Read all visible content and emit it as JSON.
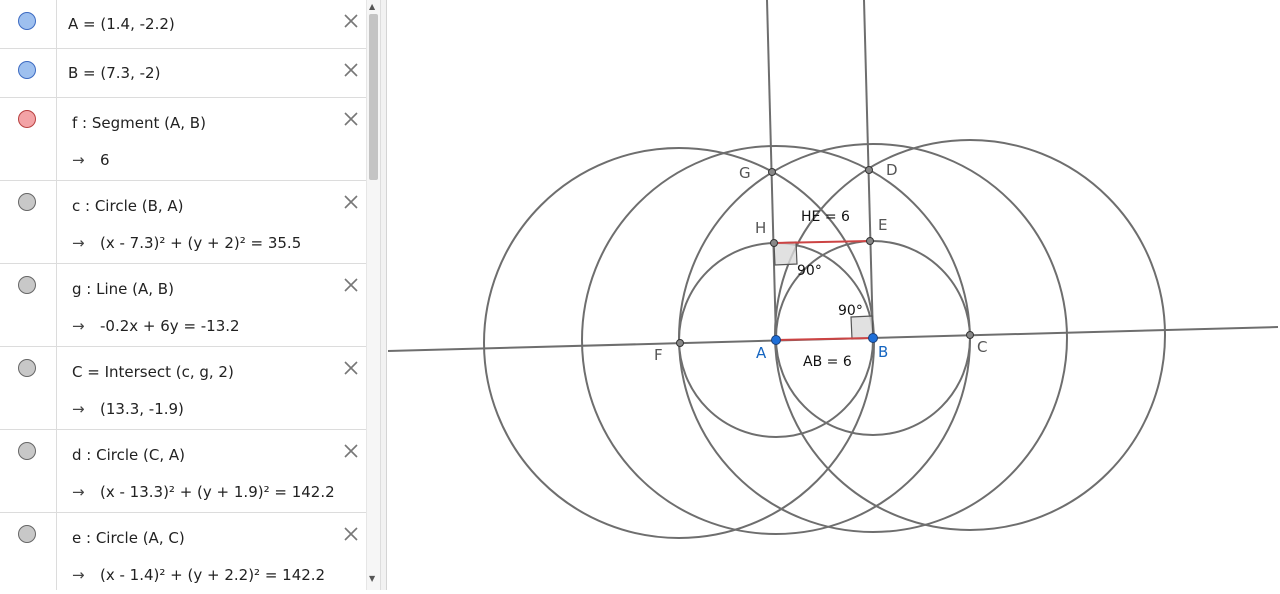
{
  "algebra": {
    "rows": [
      {
        "def": "A = (1.4, -2.2)",
        "value": null,
        "color": "#9ec0ef",
        "border": "#3d6bc2"
      },
      {
        "def": "B = (7.3, -2)",
        "value": null,
        "color": "#9ec0ef",
        "border": "#3d6bc2"
      },
      {
        "def": "f : Segment (A, B)",
        "value": "6",
        "color": "#f3a3a6",
        "border": "#b84040"
      },
      {
        "def": "c : Circle (B, A)",
        "value": "(x - 7.3)² + (y + 2)² = 35.5",
        "color": "#c8c8c8",
        "border": "#666666"
      },
      {
        "def": "g : Line (A, B)",
        "value": "-0.2x + 6y = -13.2",
        "color": "#c8c8c8",
        "border": "#666666"
      },
      {
        "def": "C = Intersect (c, g, 2)",
        "value": "(13.3, -1.9)",
        "color": "#c8c8c8",
        "border": "#666666"
      },
      {
        "def": "d : Circle (C, A)",
        "value": "(x - 13.3)² + (y + 1.9)² = 142.2",
        "color": "#c8c8c8",
        "border": "#666666"
      },
      {
        "def": "e : Circle (A, C)",
        "value": "(x - 1.4)² + (y + 2.2)² = 142.2",
        "color": "#c8c8c8",
        "border": "#666666"
      }
    ]
  },
  "graphics": {
    "points": [
      {
        "label": "A",
        "label_color": "#1565c0",
        "fill": "#1e6fd8"
      },
      {
        "label": "B",
        "label_color": "#1565c0",
        "fill": "#1e6fd8"
      },
      {
        "label": "C",
        "label_color": "#555555",
        "fill": "#888888"
      },
      {
        "label": "D",
        "label_color": "#555555",
        "fill": "#888888"
      },
      {
        "label": "E",
        "label_color": "#555555",
        "fill": "#888888"
      },
      {
        "label": "F",
        "label_color": "#555555",
        "fill": "#888888"
      },
      {
        "label": "G",
        "label_color": "#555555",
        "fill": "#888888"
      },
      {
        "label": "H",
        "label_color": "#555555",
        "fill": "#888888"
      }
    ],
    "angle_labels": [
      "90°",
      "90°"
    ],
    "segment_labels": [
      "AB = 6",
      "HE = 6"
    ],
    "segment_color": "#cc4444",
    "stroke_color": "#6e6e6e"
  }
}
